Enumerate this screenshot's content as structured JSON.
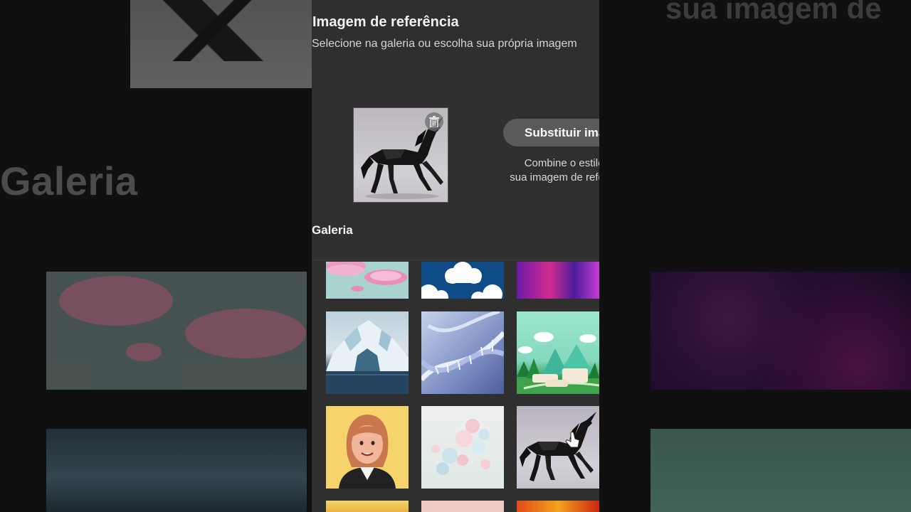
{
  "background": {
    "gallery_label": "Galeria",
    "hint_fragment": "sua imagem de"
  },
  "reference": {
    "title": "Imagem de referência",
    "subtitle": "Selecione na galeria ou escolha sua própria imagem",
    "delete_icon": "trash-icon",
    "replace_button_label": "Substituir imagem",
    "replace_description_line1": "Combine o estilo de",
    "replace_description_line2": "sua imagem de referência"
  },
  "gallery": {
    "title": "Galeria",
    "items": [
      {
        "name": "pink-discs"
      },
      {
        "name": "clouds-blue"
      },
      {
        "name": "holographic"
      },
      {
        "name": "iceberg"
      },
      {
        "name": "dna-helix"
      },
      {
        "name": "green-landscape-podiums"
      },
      {
        "name": "cartoon-woman-avatar"
      },
      {
        "name": "pastel-bubbles"
      },
      {
        "name": "origami-unicorn"
      },
      {
        "name": "yellow-forest"
      },
      {
        "name": "pink-lettering"
      },
      {
        "name": "fire-swirls"
      }
    ]
  },
  "colors": {
    "panel_bg": "#2f2f2f",
    "button_bg": "#5a5a5a",
    "text_primary": "#f2f2f2"
  }
}
